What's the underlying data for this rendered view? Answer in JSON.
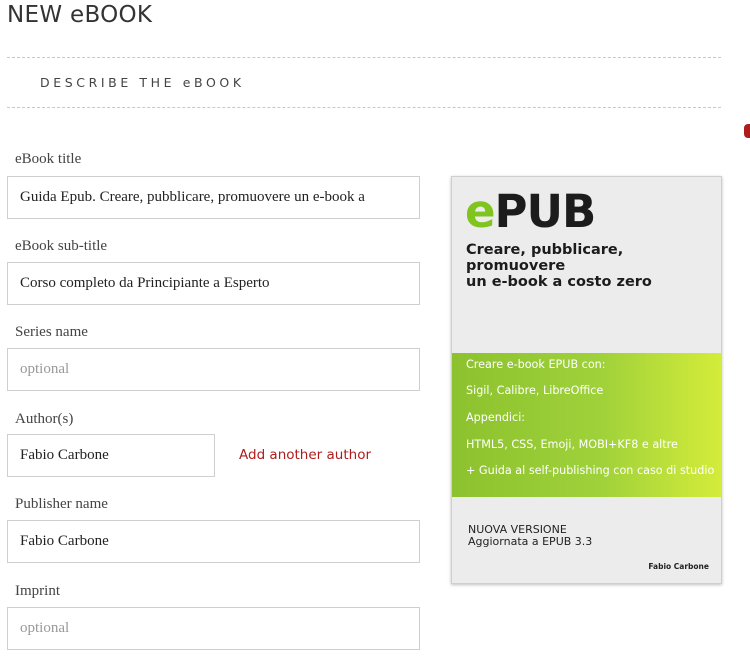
{
  "page": {
    "title": "NEW eBOOK"
  },
  "section": {
    "title": "DESCRIBE THE eBOOK"
  },
  "form": {
    "ebook_title": {
      "label": "eBook title",
      "value": "Guida Epub. Creare, pubblicare, promuovere un e-book a",
      "placeholder": ""
    },
    "ebook_subtitle": {
      "label": "eBook sub-title",
      "value": "Corso completo da Principiante a Esperto",
      "placeholder": ""
    },
    "series_name": {
      "label": "Series name",
      "value": "",
      "placeholder": "optional"
    },
    "authors": {
      "label": "Author(s)",
      "value": "Fabio Carbone",
      "placeholder": "",
      "add_link": "Add another author"
    },
    "publisher_name": {
      "label": "Publisher name",
      "value": "Fabio Carbone",
      "placeholder": ""
    },
    "imprint": {
      "label": "Imprint",
      "value": "",
      "placeholder": "optional"
    }
  },
  "cover": {
    "logo_e": "e",
    "logo_rest": "PUB",
    "subtitle_line1": "Creare, pubblicare, promuovere",
    "subtitle_line2": "un e-book a costo zero",
    "band_lines": [
      "Creare e-book EPUB con:",
      "Sigil, Calibre, LibreOffice",
      "Appendici:",
      "HTML5, CSS, Emoji, MOBI+KF8 e altre",
      "+ Guida al self-publishing con caso di studio"
    ],
    "version_line1": "NUOVA VERSIONE",
    "version_line2": "Aggiornata a EPUB 3.3",
    "author": "Fabio Carbone",
    "accent_color": "#7fc41f"
  },
  "colors": {
    "link": "#b01c1c",
    "border": "#cfcfcf",
    "text": "#333333"
  }
}
